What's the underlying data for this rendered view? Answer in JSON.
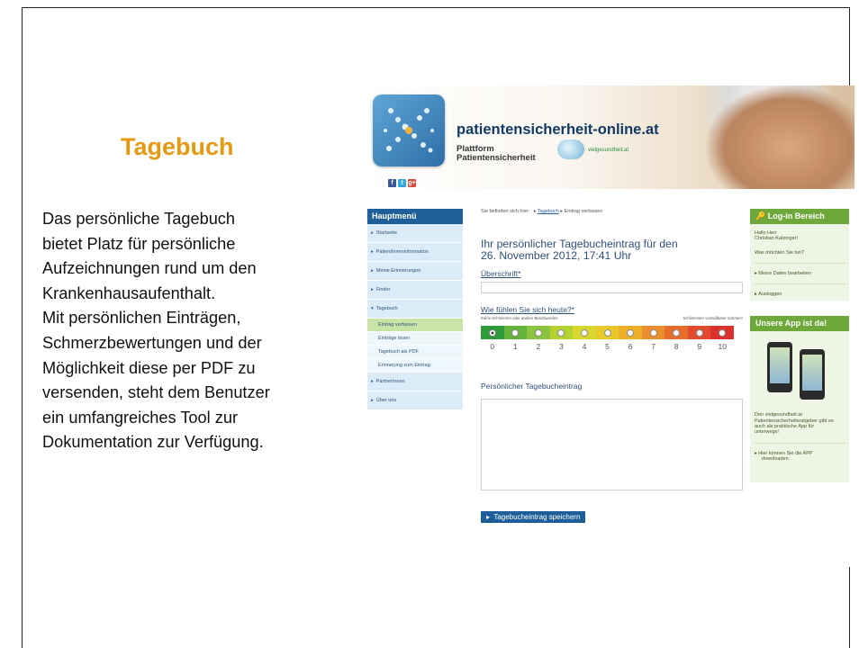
{
  "slide": {
    "title": "Tagebuch",
    "body_lines": [
      "Das persönliche Tagebuch",
      "bietet Platz für persönliche",
      "Aufzeichnungen rund um den",
      "Krankenhausaufenthalt.",
      "Mit persönlichen Einträgen,",
      "Schmerzbewertungen und der",
      "Möglichkeit diese per PDF zu",
      "versenden, steht dem Benutzer",
      "ein umfangreiches Tool zur",
      "Dokumentation zur Verfügung."
    ]
  },
  "site": {
    "name": "patientensicherheit-online.at",
    "plattform_line1": "Plattform",
    "plattform_line2": "Patientensicherheit",
    "partner": "vielgesundheit.at",
    "social": [
      "f",
      "t",
      "g+"
    ]
  },
  "nav": {
    "heading": "Hauptmenü",
    "items": [
      "Startseite",
      "PatientInneninformation",
      "Meine Erinnerungen",
      "Finder",
      "Tagebuch",
      "PartnerInnen",
      "Über uns"
    ],
    "sub_items": [
      "Eintrag verfassen",
      "Einträge lesen",
      "Tagebuch als PDF",
      "Erinnerung zum Eintrag"
    ],
    "active_sub": "Eintrag verfassen",
    "arrow": "▸",
    "arrow_open": "▾"
  },
  "breadcrumb": {
    "prefix": "Sie befinden sich hier:",
    "sep": "▸",
    "link": "Tagebuch",
    "current": "Eintrag verfassen"
  },
  "entry": {
    "title_line1": "Ihr persönlicher Tagebucheintrag für den",
    "title_line2": "26. November 2012, 17:41 Uhr",
    "heading_label": "Überschrift*",
    "pain_label": "Wie fühlen Sie sich heute?*",
    "pain_left": "Keine Schmerzen oder andere Beschwerden",
    "pain_right": "Schlimmster vorstellbarer Schmerz",
    "pain_scale": [
      "0",
      "1",
      "2",
      "3",
      "4",
      "5",
      "6",
      "7",
      "8",
      "9",
      "10"
    ],
    "pain_colors": [
      "#2f9a3a",
      "#63b33a",
      "#8bc53f",
      "#b5d233",
      "#d7d72d",
      "#e9c92a",
      "#efae2a",
      "#ec8e2b",
      "#e76d2c",
      "#e14a2c",
      "#d9322c"
    ],
    "selected_value": 0,
    "diary_label": "Persönlicher Tagebucheintrag",
    "save_button": "Tagebucheintrag speichern"
  },
  "login": {
    "heading": "Log-in Bereich",
    "greeting1": "Hallo Herr",
    "greeting2": "Christian Katzinger!",
    "question": "Was möchten Sie tun?",
    "edit_link": "Meine Daten bearbeiten",
    "logout_link": "Ausloggen"
  },
  "app": {
    "heading": "Unsere App ist da!",
    "text1": "Den vielgesundheit.at",
    "text2": "Patientensicherheitsratgeber gibt es",
    "text3": "auch als praktische App für",
    "text4": "unterwegs!",
    "download1": "Hier können Sie die APP",
    "download2": "downloaden"
  },
  "colors": {
    "title_orange": "#e39a12",
    "nav_blue": "#1e5f9a",
    "box_green": "#6ea83a"
  }
}
